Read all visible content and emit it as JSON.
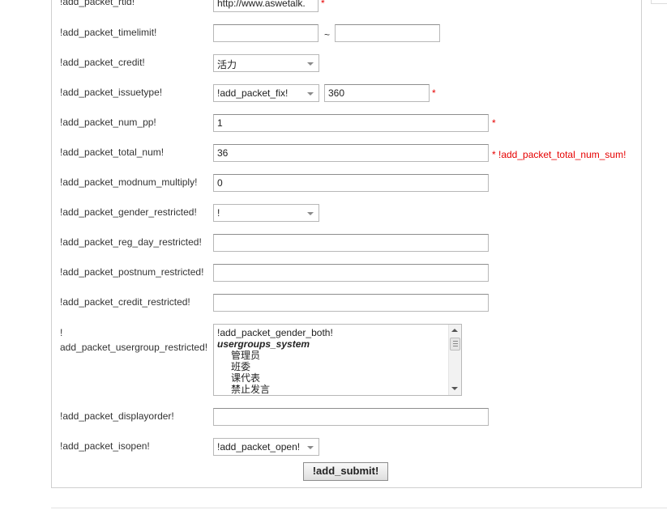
{
  "form": {
    "rows": [
      {
        "label": "!add_packet_rtid!"
      },
      {
        "label": "!add_packet_timelimit!"
      },
      {
        "label": "!add_packet_credit!"
      },
      {
        "label": "!add_packet_issuetype!"
      },
      {
        "label": "!add_packet_num_pp!"
      },
      {
        "label": "!add_packet_total_num!"
      },
      {
        "label": "!add_packet_modnum_multiply!"
      },
      {
        "label": "!add_packet_gender_restricted!"
      },
      {
        "label": "!add_packet_reg_day_restricted!"
      },
      {
        "label": "!add_packet_postnum_restricted!"
      },
      {
        "label": "!add_packet_credit_restricted!"
      },
      {
        "label": "!\nadd_packet_usergroup_restricted!"
      },
      {
        "label": "!add_packet_displayorder!"
      },
      {
        "label": "!add_packet_isopen!"
      }
    ],
    "rtid_value": "http://www.aswetalk.",
    "timelimit_start": "",
    "timelimit_sep": "~",
    "timelimit_end": "",
    "credit_selected": "活力",
    "issuetype_selected": "!add_packet_fix!",
    "issuetype_amount": "360",
    "num_pp_value": "1",
    "total_num_value": "36",
    "total_num_note": "* !add_packet_total_num_sum!",
    "modnum_value": "0",
    "gender_selected": "!",
    "reg_day_value": "",
    "postnum_value": "",
    "credit_restricted_value": "",
    "usergroup_options": [
      {
        "text": "!add_packet_gender_both!",
        "kind": "option"
      },
      {
        "text": "usergroups_system",
        "kind": "group"
      },
      {
        "text": "管理员",
        "kind": "sub"
      },
      {
        "text": "班委",
        "kind": "sub"
      },
      {
        "text": "课代表",
        "kind": "sub"
      },
      {
        "text": "禁止发言",
        "kind": "sub"
      }
    ],
    "displayorder_value": "",
    "isopen_selected": "!add_packet_open!",
    "required_mark": "*",
    "submit_label": "!add_submit!"
  },
  "colors": {
    "required": "#e60000",
    "border": "#b8b8b8",
    "text": "#333333"
  }
}
